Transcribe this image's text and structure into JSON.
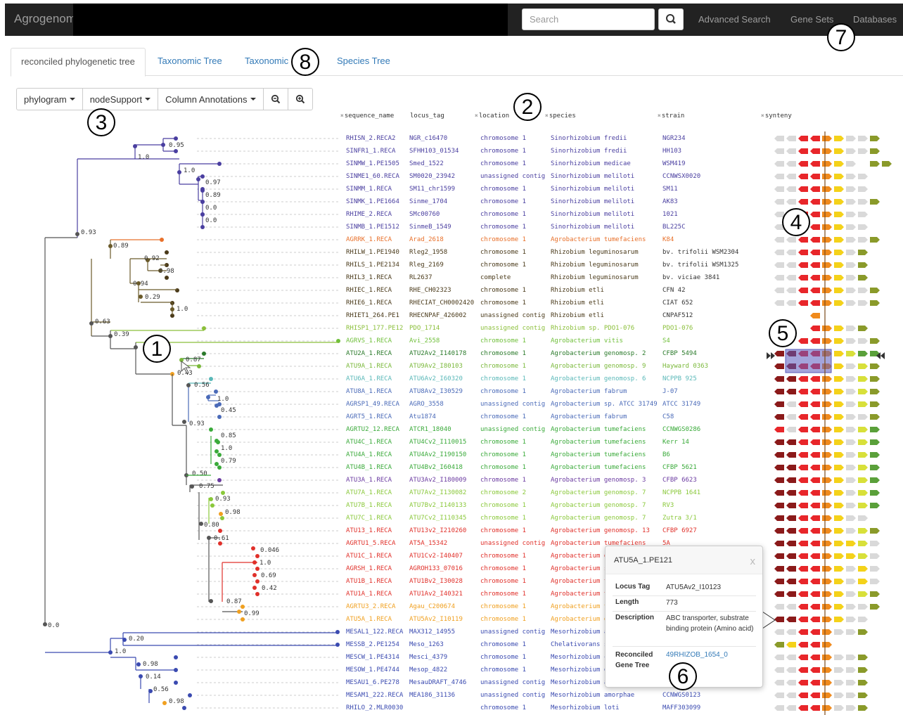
{
  "navbar": {
    "brand": "Agrogenom",
    "search_placeholder": "Search",
    "links": [
      "Advanced Search",
      "Gene Sets",
      "Databases"
    ]
  },
  "tabs": [
    "reconciled phylogenetic tree",
    "Taxonomic Tree",
    "Taxonomic",
    "Species Tree"
  ],
  "toolbar": {
    "phylogram": "phylogram",
    "node_support": "nodeSupport",
    "column_annotations": "Column Annotations"
  },
  "columns": [
    "sequence_name",
    "locus_tag",
    "location",
    "species",
    "strain",
    "synteny"
  ],
  "rows": [
    {
      "seq": "RHISN_2.RECA2",
      "locus": "NGR_c16470",
      "loc": "chromosome 1",
      "species": "Sinorhizobium fredii",
      "strain": "NGR234",
      "color": "#4a3fa0"
    },
    {
      "seq": "SINFR1_1.RECA",
      "locus": "SFHH103_01534",
      "loc": "chromosome 1",
      "species": "Sinorhizobium fredii",
      "strain": "HH103",
      "color": "#4a3fa0"
    },
    {
      "seq": "SINMW_1.PE1505",
      "locus": "Smed_1522",
      "loc": "chromosome 1",
      "species": "Sinorhizobium medicae",
      "strain": "WSM419",
      "color": "#4a3fa0"
    },
    {
      "seq": "SINME1_60.RECA",
      "locus": "SM0020_23942",
      "loc": "unassigned contig",
      "species": "Sinorhizobium meliloti",
      "strain": "CCNWSX0020",
      "color": "#4a3fa0"
    },
    {
      "seq": "SINMM_1.RECA",
      "locus": "SM11_chr1599",
      "loc": "chromosome 1",
      "species": "Sinorhizobium meliloti",
      "strain": "SM11",
      "color": "#4a3fa0"
    },
    {
      "seq": "SINMK_1.PE1664",
      "locus": "Sinme_1704",
      "loc": "chromosome 1",
      "species": "Sinorhizobium meliloti",
      "strain": "AK83",
      "color": "#4a3fa0"
    },
    {
      "seq": "RHIME_2.RECA",
      "locus": "SMc00760",
      "loc": "chromosome 1",
      "species": "Sinorhizobium meliloti",
      "strain": "1021",
      "color": "#4a3fa0"
    },
    {
      "seq": "SINMB_1.PE1512",
      "locus": "SinmeB_1549",
      "loc": "chromosome 1",
      "species": "Sinorhizobium meliloti",
      "strain": "BL225C",
      "color": "#4a3fa0"
    },
    {
      "seq": "AGRRK_1.RECA",
      "locus": "Arad_2618",
      "loc": "chromosome 1",
      "species": "Agrobacterium tumefaciens",
      "strain": "K84",
      "color": "#e8702a"
    },
    {
      "seq": "RHILW_1.PE1940",
      "locus": "Rleg2_1958",
      "loc": "chromosome 1",
      "species": "Rhizobium leguminosarum",
      "strain": "bv. trifolii WSM2304",
      "color": "#4a3a1a"
    },
    {
      "seq": "RHILS_1.PE2134",
      "locus": "Rleg_2169",
      "loc": "chromosome 1",
      "species": "Rhizobium leguminosarum",
      "strain": "bv. trifolii WSM1325",
      "color": "#4a3a1a"
    },
    {
      "seq": "RHIL3_1.RECA",
      "locus": "RL2637",
      "loc": "complete",
      "species": "Rhizobium leguminosarum",
      "strain": "bv. viciae 3841",
      "color": "#4a3a1a"
    },
    {
      "seq": "RHIEC_1.RECA",
      "locus": "RHE_CH02323",
      "loc": "chromosome 1",
      "species": "Rhizobium etli",
      "strain": "CFN 42",
      "color": "#4a3a1a"
    },
    {
      "seq": "RHIE6_1.RECA",
      "locus": "RHECIAT_CH0002420",
      "loc": "chromosome 1",
      "species": "Rhizobium etli",
      "strain": "CIAT 652",
      "color": "#4a3a1a"
    },
    {
      "seq": "RHIET1_264.PE1",
      "locus": "RHECNPAF_426002",
      "loc": "unassigned contig",
      "species": "Rhizobium etli",
      "strain": "CNPAF512",
      "color": "#4a3a1a"
    },
    {
      "seq": "RHISP1_177.PE12",
      "locus": "PDO_1714",
      "loc": "unassigned contig",
      "species": "Rhizobium sp. PDO1-076",
      "strain": "PDO1-076",
      "color": "#8bbf3a"
    },
    {
      "seq": "AGRVS_1.RECA",
      "locus": "Avi_2558",
      "loc": "chromosome 1",
      "species": "Agrobacterium vitis",
      "strain": "S4",
      "color": "#6fbf3a"
    },
    {
      "seq": "ATU2A_1.RECA",
      "locus": "ATU2Av2_I140178",
      "loc": "chromosome 1",
      "species": "Agrobacterium genomosp. 2",
      "strain": "CFBP 5494",
      "color": "#2a7a2a"
    },
    {
      "seq": "ATU9A_1.RECA",
      "locus": "ATU9Av2_I80103",
      "loc": "chromosome 1",
      "species": "Agrobacterium genomosp. 9",
      "strain": "Hayward 0363",
      "color": "#7ab83a"
    },
    {
      "seq": "ATU6A_1.RECA",
      "locus": "ATU6Av2_I60320",
      "loc": "chromosome 1",
      "species": "Agrobacterium genomosp. 6",
      "strain": "NCPPB 925",
      "color": "#5ab8b8"
    },
    {
      "seq": "ATU8A_1.RECA",
      "locus": "ATU8Av2_I30529",
      "loc": "chromosome 1",
      "species": "Agrobacterium fabrum",
      "strain": "J-07",
      "color": "#4a6ab8"
    },
    {
      "seq": "AGRSP1_49.RECA",
      "locus": "AGRO_3558",
      "loc": "unassigned contig",
      "species": "Agrobacterium sp. ATCC 31749",
      "strain": "ATCC 31749",
      "color": "#4a6ab8"
    },
    {
      "seq": "AGRT5_1.RECA",
      "locus": "Atu1874",
      "loc": "chromosome 1",
      "species": "Agrobacterium fabrum",
      "strain": "C58",
      "color": "#4a6ab8"
    },
    {
      "seq": "AGRTU2_12.RECA",
      "locus": "ATCR1_18040",
      "loc": "unassigned contig",
      "species": "Agrobacterium tumefaciens",
      "strain": "CCNWGS0286",
      "color": "#3aaa3a"
    },
    {
      "seq": "ATU4C_1.RECA",
      "locus": "ATU4Cv2_I110015",
      "loc": "chromosome 1",
      "species": "Agrobacterium tumefaciens",
      "strain": "Kerr 14",
      "color": "#3aaa3a"
    },
    {
      "seq": "ATU4A_1.RECA",
      "locus": "ATU4Av2_I190150",
      "loc": "chromosome 1",
      "species": "Agrobacterium tumefaciens",
      "strain": "B6",
      "color": "#3aaa3a"
    },
    {
      "seq": "ATU4B_1.RECA",
      "locus": "ATU4Bv2_I60418",
      "loc": "chromosome 1",
      "species": "Agrobacterium tumefaciens",
      "strain": "CFBP 5621",
      "color": "#3aaa3a"
    },
    {
      "seq": "ATU3A_1.RECA",
      "locus": "ATU3Av2_I180009",
      "loc": "chromosome 1",
      "species": "Agrobacterium genomosp. 3",
      "strain": "CFBP 6623",
      "color": "#6a3aa0"
    },
    {
      "seq": "ATU7A_1.RECA",
      "locus": "ATU7Av2_I130082",
      "loc": "chromosome 2",
      "species": "Agrobacterium genomosp. 7",
      "strain": "NCPPB 1641",
      "color": "#8ac83a"
    },
    {
      "seq": "ATU7B_1.RECA",
      "locus": "ATU7Bv2_I140133",
      "loc": "chromosome 1",
      "species": "Agrobacterium genomosp. 7",
      "strain": "RV3",
      "color": "#8ac83a"
    },
    {
      "seq": "ATU7C_1.RECA",
      "locus": "ATU7Cv2_I110345",
      "loc": "chromosome 1",
      "species": "Agrobacterium genomosp. 7",
      "strain": "Zutra 3/1",
      "color": "#8ac83a"
    },
    {
      "seq": "ATU13_1.RECA",
      "locus": "ATU13v2_I210260",
      "loc": "chromosome 1",
      "species": "Agrobacterium genomosp. 13",
      "strain": "CFBP 6927",
      "color": "#e0302a"
    },
    {
      "seq": "AGRTU1_5.RECA",
      "locus": "AT5A_15342",
      "loc": "unassigned contig",
      "species": "Agrobacterium tumefaciens",
      "strain": "5A",
      "color": "#e0302a"
    },
    {
      "seq": "ATU1C_1.RECA",
      "locus": "ATU1Cv2-I40407",
      "loc": "chromosome 1",
      "species": "Agrobacterium g",
      "strain": "",
      "color": "#e0302a"
    },
    {
      "seq": "AGRSH_1.RECA",
      "locus": "AGROH133_07016",
      "loc": "chromosome 1",
      "species": "Agrobacterium s",
      "strain": "",
      "color": "#e0302a"
    },
    {
      "seq": "ATU1B_1.RECA",
      "locus": "ATU1Bv2_I30028",
      "loc": "chromosome 1",
      "species": "Agrobacterium t",
      "strain": "",
      "color": "#e0302a"
    },
    {
      "seq": "ATU1A_1.RECA",
      "locus": "ATU1Av2_I40321",
      "loc": "chromosome 1",
      "species": "Agrobacterium t",
      "strain": "",
      "color": "#e0302a"
    },
    {
      "seq": "AGRTU3_2.RECA",
      "locus": "Agau_C200674",
      "loc": "chromosome 1",
      "species": "Agrobacterium t",
      "strain": "",
      "color": "#f0a020"
    },
    {
      "seq": "ATU5A_1.RECA",
      "locus": "ATU5Av2_I10119",
      "loc": "chromosome 1",
      "species": "Agrobacterium g",
      "strain": "",
      "color": "#f0a020"
    },
    {
      "seq": "MESAL1_122.RECA",
      "locus": "MAX312_14955",
      "loc": "unassigned contig",
      "species": "Mesorhizobium a",
      "strain": "",
      "color": "#3a4ab0"
    },
    {
      "seq": "MESSB_2.PE1254",
      "locus": "Meso_1263",
      "loc": "chromosome 1",
      "species": "Chelativorans s",
      "strain": "",
      "color": "#3a4ab0"
    },
    {
      "seq": "MESCW_1.PE4314",
      "locus": "Mesci_4379",
      "loc": "chromosome 1",
      "species": "Mesorhizobium c",
      "strain": "",
      "color": "#3a4ab0"
    },
    {
      "seq": "MESOW_1.PE4744",
      "locus": "Mesop_4822",
      "loc": "chromosome 1",
      "species": "Mesorhizobium o",
      "strain": "",
      "color": "#3a4ab0"
    },
    {
      "seq": "MESAU1_6.PE278",
      "locus": "MesauDRAFT_4746",
      "loc": "unassigned contig",
      "species": "Mesorhizobium a",
      "strain": "",
      "color": "#3a4ab0"
    },
    {
      "seq": "MESAM1_222.RECA",
      "locus": "MEA186_31136",
      "loc": "unassigned contig",
      "species": "Mesorhizobium amorphae",
      "strain": "CCNWGS0123",
      "color": "#3a4ab0"
    },
    {
      "seq": "RHILO_2.MLR0030",
      "locus": "",
      "loc": "chromosome 1",
      "species": "Mesorhizobium loti",
      "strain": "MAFF303099",
      "color": "#3a4ab0"
    }
  ],
  "support_values": [
    "0.95",
    "1.0",
    "1.0",
    "0.97",
    "0.89",
    "0.0",
    "0.0",
    "0.93",
    "0.89",
    "0.92",
    "0.98",
    "0.94",
    "0.29",
    "1.0",
    "0.63",
    "0.39",
    "0.87",
    "0.43",
    "0.56",
    "1.0",
    "0.45",
    "0.93",
    "0.85",
    "1.0",
    "0.79",
    "0.50",
    "0.75",
    "0.93",
    "0.98",
    "0.80",
    "0.61",
    "0.046",
    "1.0",
    "0.69",
    "0.42",
    "0.87",
    "0.99",
    "0.0",
    "0.20",
    "1.0",
    "0.98",
    "0.14",
    "0.56",
    "0.98"
  ],
  "popover": {
    "title": "ATU5A_1.PE121",
    "close": "x",
    "locus_tag_label": "Locus Tag",
    "locus_tag": "ATU5Av2_I10123",
    "length_label": "Length",
    "length": "773",
    "description_label": "Description",
    "description": "ABC transporter, substrate binding protein (Amino acid)",
    "reconciled_label": "Reconciled Gene Tree",
    "reconciled": "49RHIZOB_1654_0"
  },
  "callouts": [
    "1",
    "2",
    "3",
    "4",
    "5",
    "6",
    "7",
    "8"
  ],
  "colors": {
    "navbar": "#222222",
    "link": "#337ab7",
    "gene_gray": "#d9d9d9",
    "gene_darkred": "#8b1a1a",
    "gene_red": "#e8262a",
    "gene_orange": "#f08a1c",
    "gene_yellow": "#f4d21a",
    "gene_lime": "#d8e03a",
    "gene_olive": "#8a9a2a",
    "gene_green": "#5aa03a",
    "selection": "#6a6ab8"
  }
}
